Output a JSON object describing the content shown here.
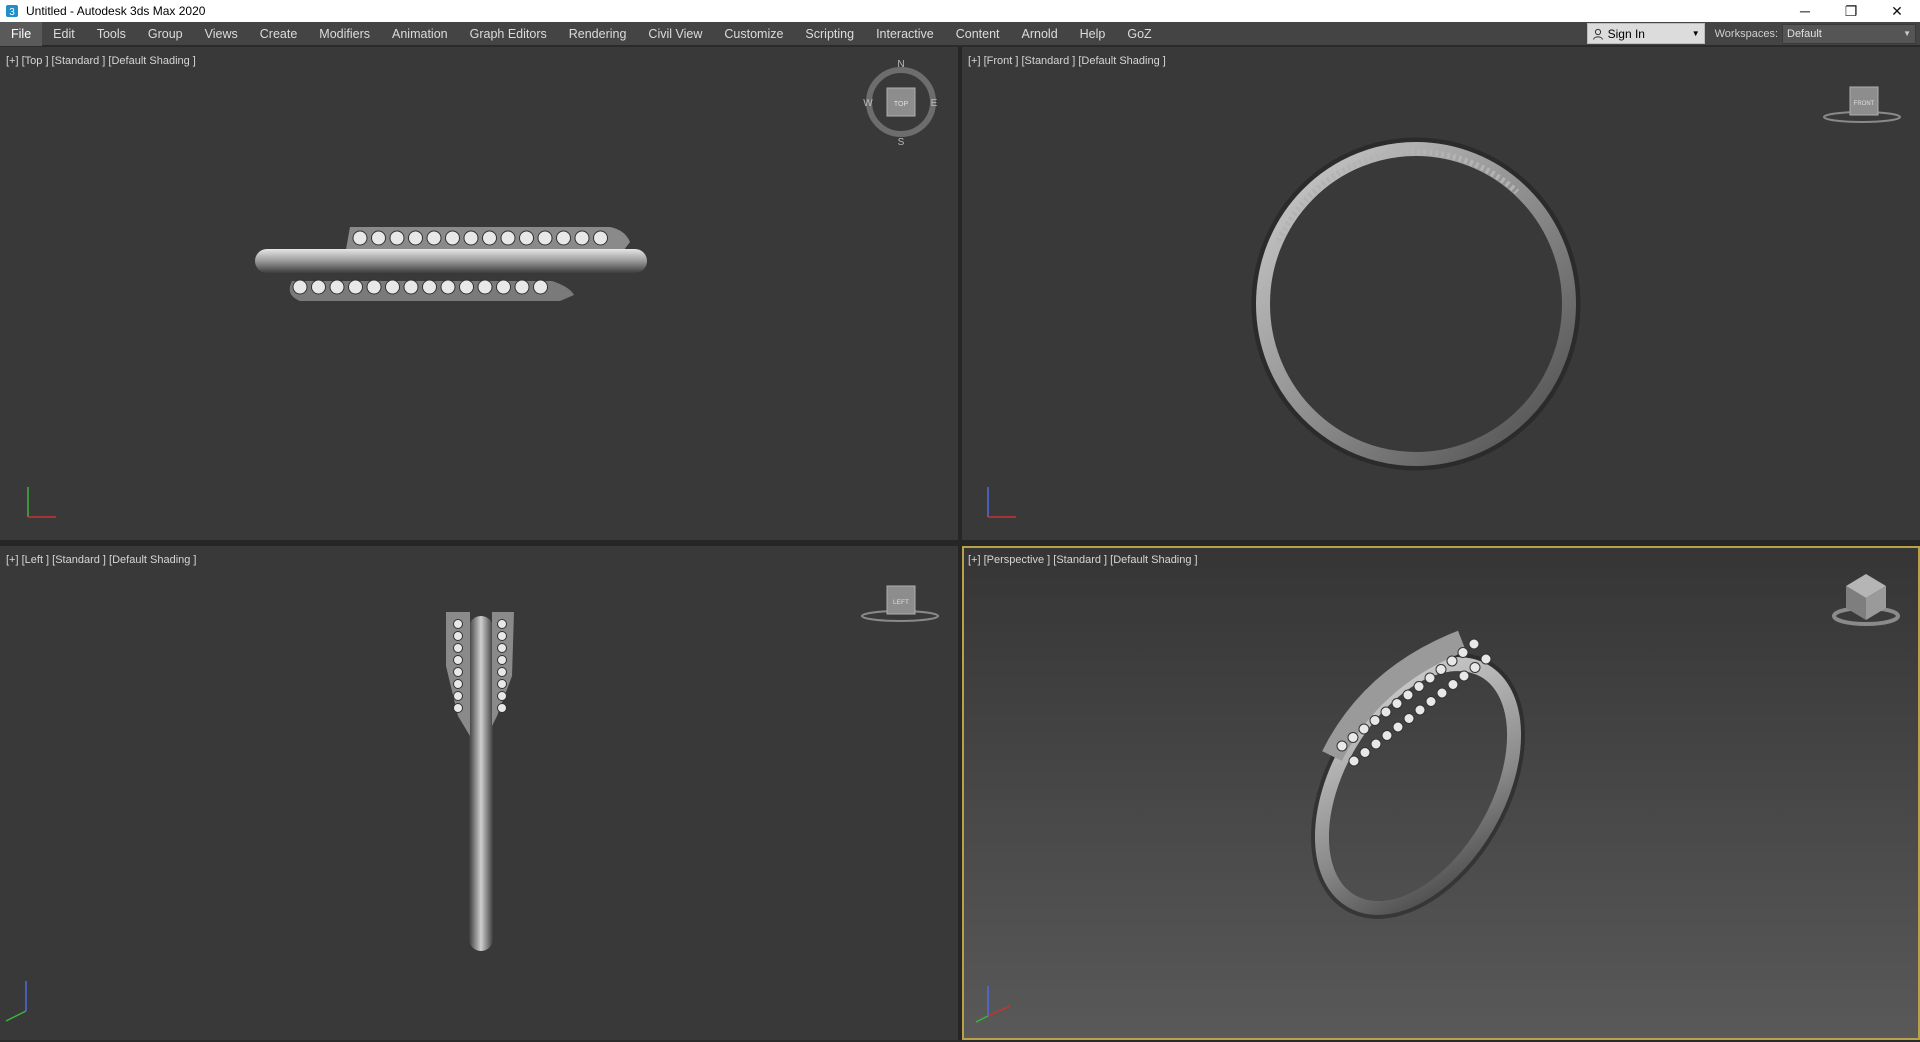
{
  "window": {
    "title": "Untitled - Autodesk 3ds Max 2020",
    "app_icon": "3ds-max-icon",
    "controls": {
      "minimize": "─",
      "restore": "❐",
      "close": "✕"
    }
  },
  "menubar": {
    "items": [
      "File",
      "Edit",
      "Tools",
      "Group",
      "Views",
      "Create",
      "Modifiers",
      "Animation",
      "Graph Editors",
      "Rendering",
      "Civil View",
      "Customize",
      "Scripting",
      "Interactive",
      "Content",
      "Arnold",
      "Help",
      "GoZ"
    ],
    "active_index": 0,
    "sign_in": "Sign In",
    "workspaces_label": "Workspaces:",
    "workspace_value": "Default"
  },
  "viewports": {
    "top": {
      "label": "[+] [Top ] [Standard ] [Default Shading ]",
      "viewcube": "TOP",
      "compass": {
        "n": "N",
        "s": "S",
        "e": "E",
        "w": "W"
      }
    },
    "front": {
      "label": "[+] [Front ] [Standard ] [Default Shading ]",
      "viewcube": "FRONT"
    },
    "left": {
      "label": "[+] [Left ] [Standard ] [Default Shading ]",
      "viewcube": "LEFT"
    },
    "perspective": {
      "label": "[+] [Perspective ] [Standard ] [Default Shading ]",
      "viewcube": "perspective"
    }
  },
  "colors": {
    "viewport_bg": "#393939",
    "active_viewport_border": "#b8a14a",
    "menubar_bg": "#444444",
    "axis_x": "#c83232",
    "axis_y": "#3cb43c",
    "axis_z": "#4a6ee0"
  }
}
